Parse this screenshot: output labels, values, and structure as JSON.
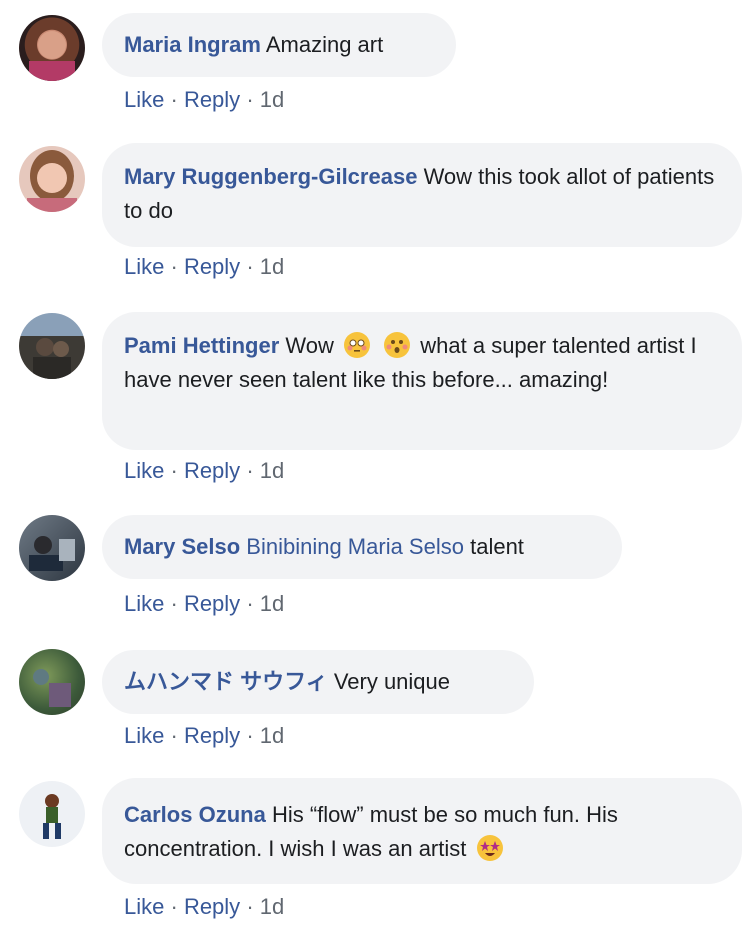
{
  "comments": [
    {
      "author": "Maria Ingram",
      "mention": "",
      "text": "Amazing art",
      "text_after_emoji": "",
      "emojis": [],
      "actions": {
        "like": "Like",
        "reply": "Reply",
        "time": "1d"
      }
    },
    {
      "author": "Mary Ruggenberg-Gilcrease",
      "mention": "",
      "text": "Wow this took allot of patients to do",
      "emojis": [],
      "actions": {
        "like": "Like",
        "reply": "Reply",
        "time": "1d"
      }
    },
    {
      "author": "Pami Hettinger",
      "mention": "",
      "text_before": "Wow",
      "text": "what a super talented artist I have never seen talent like this before... amazing!",
      "emojis": [
        "flushed-face",
        "hushed-face"
      ],
      "actions": {
        "like": "Like",
        "reply": "Reply",
        "time": "1d"
      }
    },
    {
      "author": "Mary Selso",
      "mention": "Binibining Maria Selso",
      "text": "talent",
      "emojis": [],
      "actions": {
        "like": "Like",
        "reply": "Reply",
        "time": "1d"
      }
    },
    {
      "author": "ムハンマド サウフィ",
      "mention": "",
      "text": "Very unique",
      "emojis": [],
      "actions": {
        "like": "Like",
        "reply": "Reply",
        "time": "1d"
      }
    },
    {
      "author": "Carlos Ozuna",
      "mention": "",
      "text": "His “flow” must be so much fun. His concentration. I wish I was an artist",
      "emojis": [
        "star-struck-face"
      ],
      "actions": {
        "like": "Like",
        "reply": "Reply",
        "time": "1d"
      }
    }
  ],
  "separator": "·",
  "colors": {
    "link": "#385898",
    "bubble": "#f2f3f5",
    "meta": "#606770",
    "text": "#1c1e21"
  }
}
